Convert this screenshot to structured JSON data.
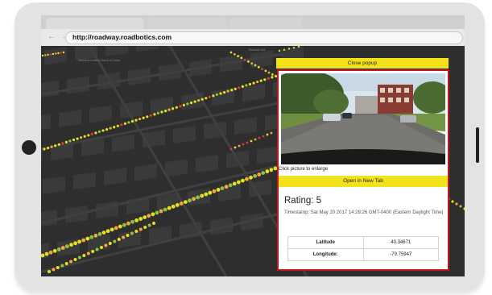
{
  "browser": {
    "url": "http://roadway.roadbotics.com",
    "nav_arrows": "← →"
  },
  "map": {
    "poi_label": "Bellefield United Church of Christ",
    "street_label": "Ellsworth Ave"
  },
  "popup": {
    "close_label": "Close popup",
    "enlarge_hint": "Click picture to enlarge",
    "open_tab_label": "Open in New Tab",
    "rating_label": "Rating: 5",
    "timestamp": "Timestamp: Sat May 20 2017 14:28:26 GMT-0400 (Eastern Daylight Time)",
    "coords": {
      "latitude_label": "Latitude",
      "latitude_value": "40.34671",
      "longitude_label": "Longitude:",
      "longitude_value": "-79.75947"
    }
  },
  "colors": {
    "popup_accent": "#f2e21c",
    "popup_border": "#c4151c",
    "rating_good": "#e6e21a",
    "rating_fair": "#8bc34a",
    "rating_poor": "#e53935",
    "rating_mid": "#f4a742"
  }
}
